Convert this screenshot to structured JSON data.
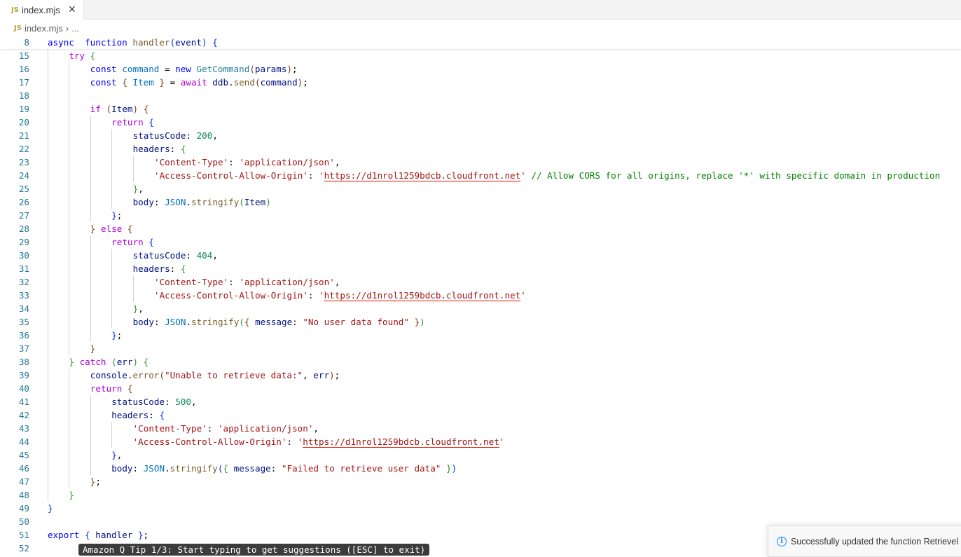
{
  "tab": {
    "badge": "JS",
    "filename": "index.mjs",
    "close_glyph": "✕"
  },
  "breadcrumb": {
    "badge": "JS",
    "file": "index.mjs",
    "separator": "›",
    "more": "..."
  },
  "editor": {
    "lines": [
      {
        "n": "8",
        "indent": 0,
        "sticky": true,
        "tokens": [
          [
            "kw",
            "async"
          ],
          [
            "",
            "  "
          ],
          [
            "kw",
            "function"
          ],
          [
            "",
            " "
          ],
          [
            "fn",
            "handler"
          ],
          [
            "b1",
            "("
          ],
          [
            "vr",
            "event"
          ],
          [
            "b1",
            ")"
          ],
          [
            "",
            " "
          ],
          [
            "b1",
            "{"
          ]
        ]
      },
      {
        "n": "15",
        "indent": 1,
        "tokens": [
          [
            "ctl",
            "try"
          ],
          [
            "",
            " "
          ],
          [
            "b2",
            "{"
          ]
        ]
      },
      {
        "n": "16",
        "indent": 2,
        "tokens": [
          [
            "kw",
            "const"
          ],
          [
            "",
            " "
          ],
          [
            "cn",
            "command"
          ],
          [
            "",
            " = "
          ],
          [
            "kw",
            "new"
          ],
          [
            "",
            " "
          ],
          [
            "ty",
            "GetCommand"
          ],
          [
            "b3",
            "("
          ],
          [
            "vr",
            "params"
          ],
          [
            "b3",
            ")"
          ],
          [
            "",
            ";"
          ]
        ]
      },
      {
        "n": "17",
        "indent": 2,
        "tokens": [
          [
            "kw",
            "const"
          ],
          [
            "",
            " "
          ],
          [
            "b3",
            "{"
          ],
          [
            "",
            " "
          ],
          [
            "cn",
            "Item"
          ],
          [
            "",
            " "
          ],
          [
            "b3",
            "}"
          ],
          [
            "",
            " = "
          ],
          [
            "ctl",
            "await"
          ],
          [
            "",
            " "
          ],
          [
            "vr",
            "ddb"
          ],
          [
            "",
            "."
          ],
          [
            "fn",
            "send"
          ],
          [
            "b3",
            "("
          ],
          [
            "vr",
            "command"
          ],
          [
            "b3",
            ")"
          ],
          [
            "",
            ";"
          ]
        ]
      },
      {
        "n": "18",
        "indent": 0,
        "tokens": []
      },
      {
        "n": "19",
        "indent": 2,
        "tokens": [
          [
            "ctl",
            "if"
          ],
          [
            "",
            " "
          ],
          [
            "b3",
            "("
          ],
          [
            "vr",
            "Item"
          ],
          [
            "b3",
            ")"
          ],
          [
            "",
            " "
          ],
          [
            "b3",
            "{"
          ]
        ]
      },
      {
        "n": "20",
        "indent": 3,
        "tokens": [
          [
            "ctl",
            "return"
          ],
          [
            "",
            " "
          ],
          [
            "b1",
            "{"
          ]
        ]
      },
      {
        "n": "21",
        "indent": 4,
        "tokens": [
          [
            "vr",
            "statusCode"
          ],
          [
            "",
            ": "
          ],
          [
            "nm",
            "200"
          ],
          [
            "",
            ","
          ]
        ]
      },
      {
        "n": "22",
        "indent": 4,
        "tokens": [
          [
            "vr",
            "headers"
          ],
          [
            "",
            ": "
          ],
          [
            "b2",
            "{"
          ]
        ]
      },
      {
        "n": "23",
        "indent": 5,
        "tokens": [
          [
            "st",
            "'Content-Type'"
          ],
          [
            "",
            ": "
          ],
          [
            "st",
            "'application/json'"
          ],
          [
            "",
            ","
          ]
        ]
      },
      {
        "n": "24",
        "indent": 5,
        "tokens": [
          [
            "st",
            "'Access-Control-Allow-Origin'"
          ],
          [
            "",
            ": "
          ],
          [
            "st",
            "'"
          ],
          [
            "st url",
            "https://d1nrol1259bdcb.cloudfront.net"
          ],
          [
            "st",
            "'"
          ],
          [
            "",
            " "
          ],
          [
            "cm",
            "// Allow CORS for all origins, replace '*' with specific domain in production"
          ]
        ]
      },
      {
        "n": "25",
        "indent": 4,
        "tokens": [
          [
            "b2",
            "}"
          ],
          [
            "",
            ","
          ]
        ]
      },
      {
        "n": "26",
        "indent": 4,
        "tokens": [
          [
            "vr",
            "body"
          ],
          [
            "",
            ": "
          ],
          [
            "cn",
            "JSON"
          ],
          [
            "",
            "."
          ],
          [
            "fn",
            "stringify"
          ],
          [
            "b2",
            "("
          ],
          [
            "vr",
            "Item"
          ],
          [
            "b2",
            ")"
          ]
        ]
      },
      {
        "n": "27",
        "indent": 3,
        "tokens": [
          [
            "b1",
            "}"
          ],
          [
            "",
            ";"
          ]
        ]
      },
      {
        "n": "28",
        "indent": 2,
        "tokens": [
          [
            "b3",
            "}"
          ],
          [
            "",
            " "
          ],
          [
            "ctl",
            "else"
          ],
          [
            "",
            " "
          ],
          [
            "b3",
            "{"
          ]
        ]
      },
      {
        "n": "29",
        "indent": 3,
        "tokens": [
          [
            "ctl",
            "return"
          ],
          [
            "",
            " "
          ],
          [
            "b1",
            "{"
          ]
        ]
      },
      {
        "n": "30",
        "indent": 4,
        "tokens": [
          [
            "vr",
            "statusCode"
          ],
          [
            "",
            ": "
          ],
          [
            "nm",
            "404"
          ],
          [
            "",
            ","
          ]
        ]
      },
      {
        "n": "31",
        "indent": 4,
        "tokens": [
          [
            "vr",
            "headers"
          ],
          [
            "",
            ": "
          ],
          [
            "b2",
            "{"
          ]
        ]
      },
      {
        "n": "32",
        "indent": 5,
        "tokens": [
          [
            "st",
            "'Content-Type'"
          ],
          [
            "",
            ": "
          ],
          [
            "st",
            "'application/json'"
          ],
          [
            "",
            ","
          ]
        ]
      },
      {
        "n": "33",
        "indent": 5,
        "tokens": [
          [
            "st",
            "'Access-Control-Allow-Origin'"
          ],
          [
            "",
            ": "
          ],
          [
            "st",
            "'"
          ],
          [
            "st url",
            "https://d1nrol1259bdcb.cloudfront.net"
          ],
          [
            "st",
            "'"
          ]
        ]
      },
      {
        "n": "34",
        "indent": 4,
        "tokens": [
          [
            "b2",
            "}"
          ],
          [
            "",
            ","
          ]
        ]
      },
      {
        "n": "35",
        "indent": 4,
        "tokens": [
          [
            "vr",
            "body"
          ],
          [
            "",
            ": "
          ],
          [
            "cn",
            "JSON"
          ],
          [
            "",
            "."
          ],
          [
            "fn",
            "stringify"
          ],
          [
            "b2",
            "("
          ],
          [
            "b3",
            "{"
          ],
          [
            "",
            " "
          ],
          [
            "vr",
            "message"
          ],
          [
            "",
            ": "
          ],
          [
            "st",
            "\"No user data found\""
          ],
          [
            "",
            " "
          ],
          [
            "b3",
            "}"
          ],
          [
            "b2",
            ")"
          ]
        ]
      },
      {
        "n": "36",
        "indent": 3,
        "tokens": [
          [
            "b1",
            "}"
          ],
          [
            "",
            ";"
          ]
        ]
      },
      {
        "n": "37",
        "indent": 2,
        "tokens": [
          [
            "b3",
            "}"
          ]
        ]
      },
      {
        "n": "38",
        "indent": 1,
        "tokens": [
          [
            "b2",
            "}"
          ],
          [
            "",
            " "
          ],
          [
            "ctl",
            "catch"
          ],
          [
            "",
            " "
          ],
          [
            "b2",
            "("
          ],
          [
            "vr",
            "err"
          ],
          [
            "b2",
            ")"
          ],
          [
            "",
            " "
          ],
          [
            "b2",
            "{"
          ]
        ]
      },
      {
        "n": "39",
        "indent": 2,
        "tokens": [
          [
            "vr",
            "console"
          ],
          [
            "",
            "."
          ],
          [
            "fn",
            "error"
          ],
          [
            "b3",
            "("
          ],
          [
            "st",
            "\"Unable to retrieve data:\""
          ],
          [
            "",
            ", "
          ],
          [
            "vr",
            "err"
          ],
          [
            "b3",
            ")"
          ],
          [
            "",
            ";"
          ]
        ]
      },
      {
        "n": "40",
        "indent": 2,
        "tokens": [
          [
            "ctl",
            "return"
          ],
          [
            "",
            " "
          ],
          [
            "b3",
            "{"
          ]
        ]
      },
      {
        "n": "41",
        "indent": 3,
        "tokens": [
          [
            "vr",
            "statusCode"
          ],
          [
            "",
            ": "
          ],
          [
            "nm",
            "500"
          ],
          [
            "",
            ","
          ]
        ]
      },
      {
        "n": "42",
        "indent": 3,
        "tokens": [
          [
            "vr",
            "headers"
          ],
          [
            "",
            ": "
          ],
          [
            "b1",
            "{"
          ]
        ]
      },
      {
        "n": "43",
        "indent": 4,
        "tokens": [
          [
            "st",
            "'Content-Type'"
          ],
          [
            "",
            ": "
          ],
          [
            "st",
            "'application/json'"
          ],
          [
            "",
            ","
          ]
        ]
      },
      {
        "n": "44",
        "indent": 4,
        "tokens": [
          [
            "st",
            "'Access-Control-Allow-Origin'"
          ],
          [
            "",
            ": "
          ],
          [
            "st",
            "'"
          ],
          [
            "st url",
            "https://d1nrol1259bdcb.cloudfront.net"
          ],
          [
            "st",
            "'"
          ]
        ]
      },
      {
        "n": "45",
        "indent": 3,
        "tokens": [
          [
            "b1",
            "}"
          ],
          [
            "",
            ","
          ]
        ]
      },
      {
        "n": "46",
        "indent": 3,
        "tokens": [
          [
            "vr",
            "body"
          ],
          [
            "",
            ": "
          ],
          [
            "cn",
            "JSON"
          ],
          [
            "",
            "."
          ],
          [
            "fn",
            "stringify"
          ],
          [
            "b1",
            "("
          ],
          [
            "b2",
            "{"
          ],
          [
            "",
            " "
          ],
          [
            "vr",
            "message"
          ],
          [
            "",
            ": "
          ],
          [
            "st",
            "\"Failed to retrieve user data\""
          ],
          [
            "",
            " "
          ],
          [
            "b2",
            "}"
          ],
          [
            "b1",
            ")"
          ]
        ]
      },
      {
        "n": "47",
        "indent": 2,
        "tokens": [
          [
            "b3",
            "}"
          ],
          [
            "",
            ";"
          ]
        ]
      },
      {
        "n": "48",
        "indent": 1,
        "tokens": [
          [
            "b2",
            "}"
          ]
        ]
      },
      {
        "n": "49",
        "indent": 0,
        "tokens": [
          [
            "b1",
            "}"
          ]
        ]
      },
      {
        "n": "50",
        "indent": 0,
        "tokens": []
      },
      {
        "n": "51",
        "indent": 0,
        "tokens": [
          [
            "kw",
            "export"
          ],
          [
            "",
            " "
          ],
          [
            "b1",
            "{"
          ],
          [
            "",
            " "
          ],
          [
            "vr",
            "handler"
          ],
          [
            "",
            " "
          ],
          [
            "b1",
            "}"
          ],
          [
            "",
            ";"
          ]
        ]
      },
      {
        "n": "52",
        "indent": 0,
        "tokens": []
      }
    ]
  },
  "amazon_q_tip": {
    "text": "Amazon Q Tip 1/3: Start typing to get suggestions ([ESC] to exit)"
  },
  "notification": {
    "icon": "info-icon",
    "message": "Successfully updated the function Retrievel"
  },
  "colors": {
    "accent": "#1a85ff",
    "line_number": "#237893",
    "keyword": "#0000ff",
    "string": "#a31515",
    "comment": "#008000"
  }
}
